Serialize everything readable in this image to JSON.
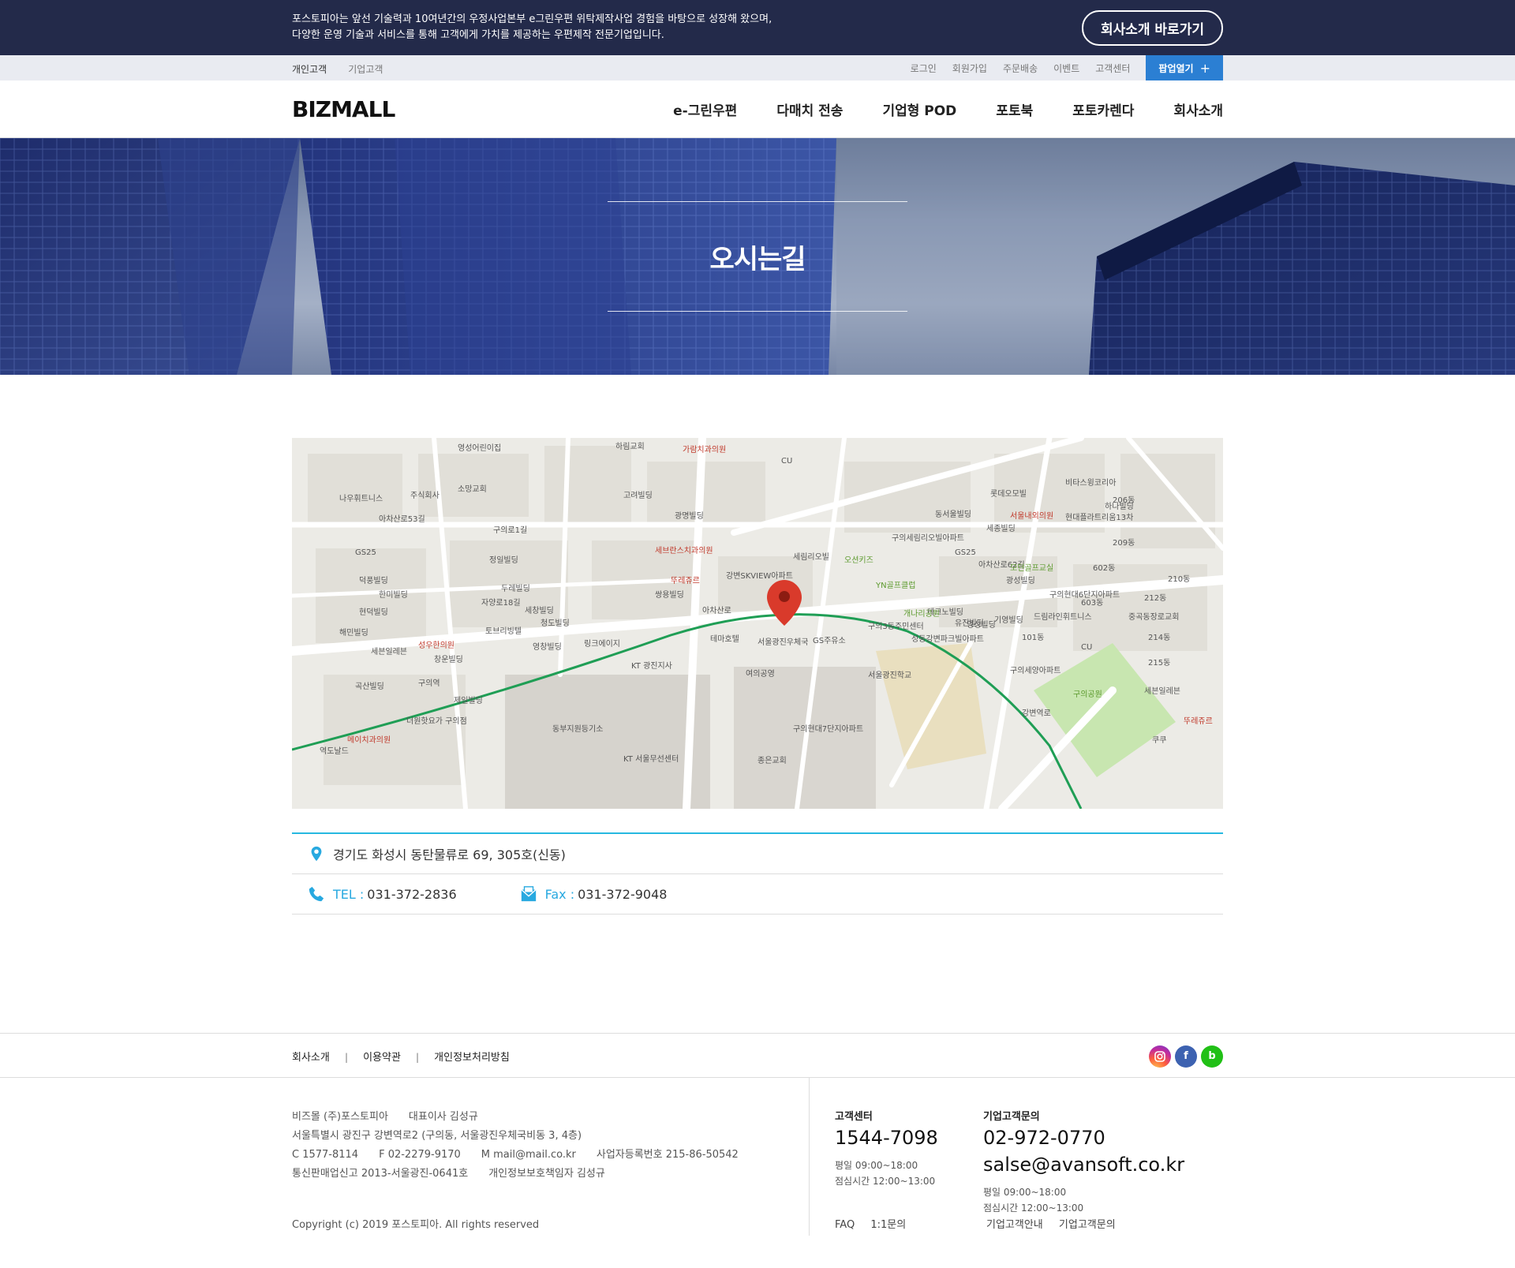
{
  "notice": {
    "line1": "포스토피아는 앞선 기술력과 10여년간의 우정사업본부 e그린우편 위탁제작사업 경험을 바탕으로 성장해 왔으며,",
    "line2": "다양한 운영 기술과 서비스를 통해 고객에게 가치를 제공하는 우편제작 전문기업입니다.",
    "button": "회사소개 바로가기"
  },
  "util": {
    "left": [
      "개인고객",
      "기업고객"
    ],
    "right": [
      "로그인",
      "회원가입",
      "주문배송",
      "이벤트",
      "고객센터"
    ],
    "popup": "팝업열기",
    "popup_icon": "plus-icon"
  },
  "gnb": {
    "logo": "BIZMALL",
    "menu": [
      "e-그린우편",
      "다매치 전송",
      "기업형 POD",
      "포토북",
      "포토카렌다",
      "회사소개"
    ]
  },
  "hero": {
    "title": "오시는길"
  },
  "map": {
    "labels": [
      "영성어린이집",
      "하림교회",
      "가람치과의원",
      "CU",
      "나우휘트니스",
      "주식회사",
      "소망교회",
      "아차산로53길",
      "구의로1길",
      "고려빌딩",
      "광명빌딩",
      "GS25",
      "정일빌딩",
      "세브란스치과의원",
      "뚜레쥬르",
      "강변SKVIEW아파트",
      "세림리오빌",
      "오션키즈",
      "YN골프클럽",
      "덕풍빌딩",
      "한미빌딩",
      "두레빌딩",
      "쌍용빌딩",
      "현덕빌딩",
      "자양로18길",
      "세창빌딩",
      "청도빌딩",
      "테마호텔",
      "서울광진우체국",
      "GS주유소",
      "구의3동주민센터",
      "해민빌딩",
      "토브리빙텔",
      "성우한의원",
      "세븐일레븐",
      "영창빌딩",
      "링크에이지",
      "창운빌딩",
      "KT 광진지사",
      "여의공영",
      "서울광진학교",
      "곡산빌딩",
      "구의역",
      "제일빌딩",
      "더원핫요가 구의점",
      "동부지원등기소",
      "메이치과의원",
      "역도날드",
      "KT 서울무선센터",
      "구의현대7단지아파트",
      "롯데오모빌",
      "서울내외의원",
      "비타스윙코리아",
      "하나빌딩",
      "현대플라트리움13차",
      "동서울빌딩",
      "세종빌딩",
      "구의세림리오빌아파트",
      "아차산로62길",
      "모던골프교실",
      "광성빌딩",
      "구의현대6단지아파트",
      "테크노빌딩",
      "유진빌딩",
      "기영빌딩",
      "개나리공원",
      "드림라인휘트니스",
      "영성빌딩",
      "성동강변파크빌아파트",
      "구의세양아파트",
      "구의공원",
      "세븐일레븐",
      "중곡동장로교회",
      "뚜레쥬르",
      "쿠쿠",
      "아차산로",
      "강변역로",
      "GS25",
      "206동",
      "209동",
      "602동",
      "603동",
      "210동",
      "212동",
      "214동",
      "215동",
      "101동",
      "종은교회",
      "CU"
    ]
  },
  "info": {
    "address": "경기도 화성시 동탄물류로 69, 305호(신동)",
    "tel_label": "TEL :",
    "tel": "031-372-2836",
    "fax_label": "Fax :",
    "fax": "031-372-9048"
  },
  "footer": {
    "links": [
      "회사소개",
      "이용약관",
      "개인정보처리방침"
    ],
    "sep": "|",
    "sns": [
      "instagram-icon",
      "facebook-icon",
      "band-icon"
    ],
    "sns_letters": {
      "fb": "f",
      "bd": "b"
    },
    "company": {
      "l1a": "비즈몰 (주)포스토피아",
      "l1b": "대표이사  김성규",
      "l2": "서울특별시 광진구 강변역로2 (구의동, 서울광진우체국비동 3, 4층)",
      "l3a": "C  1577-8114",
      "l3b": "F  02-2279-9170",
      "l3c": "M  mail@mail.co.kr",
      "l3d": "사업자등록번호  215-86-50542",
      "l4a": "통신판매업신고  2013-서울광진-0641호",
      "l4b": "개인정보보호책임자  김성규",
      "copyright": "Copyright (c) 2019 포스토피아. All rights reserved"
    },
    "cs": {
      "title": "고객센터",
      "phone": "1544-7098",
      "hours1": "평일 09:00~18:00",
      "hours2": "점심시간 12:00~13:00",
      "link1": "FAQ",
      "link2": "1:1문의"
    },
    "biz": {
      "title": "기업고객문의",
      "phone": "02-972-0770",
      "email": "salse@avansoft.co.kr",
      "hours1": "평일 09:00~18:00",
      "hours2": "점심시간 12:00~13:00",
      "link1": "기업고객안내",
      "link2": "기업고객문의"
    }
  },
  "colors": {
    "navy": "#232a4a",
    "accent": "#27b8e0",
    "popup": "#2b7fd3"
  }
}
